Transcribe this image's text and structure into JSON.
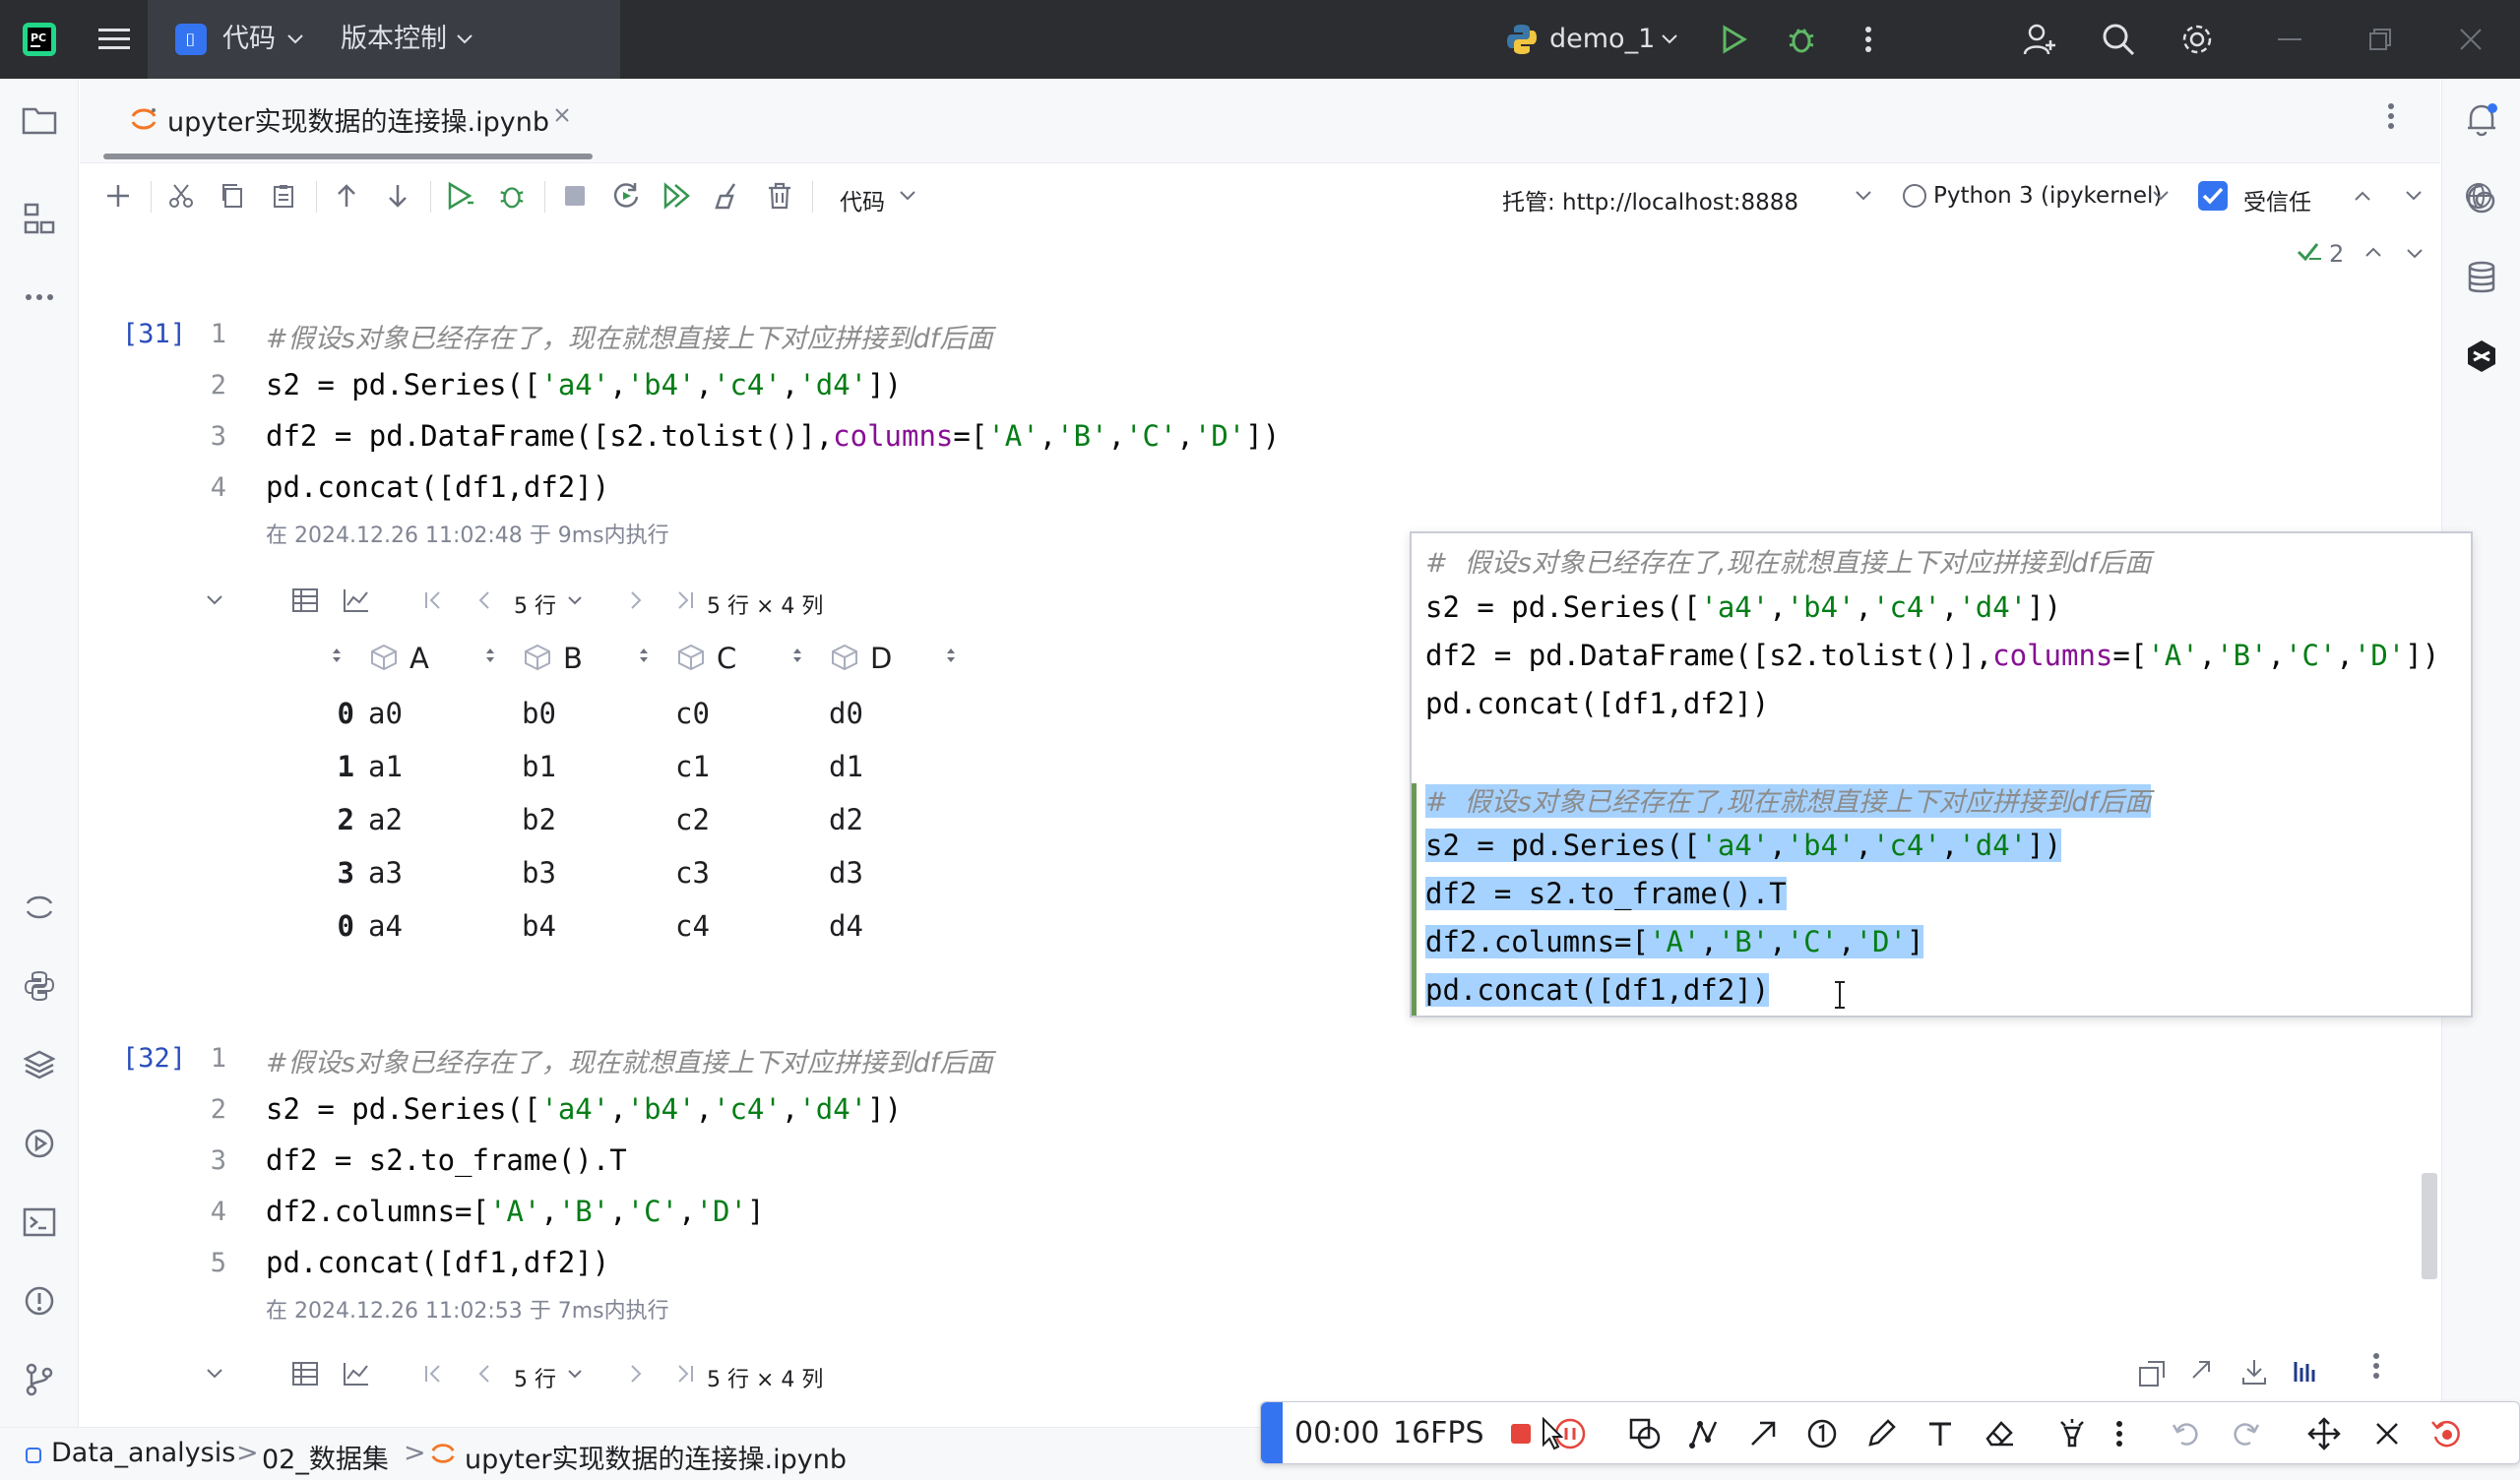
{
  "titlebar": {
    "app_logo": "pycharm-logo",
    "project_name": "代码",
    "vcs_label": "版本控制",
    "run_config": "demo_1"
  },
  "tab": {
    "file_name": "upyter实现数据的连接操.ipynb"
  },
  "nb_toolbar": {
    "cell_type": "代码",
    "host_label": "托管: http://localhost:8888",
    "kernel_label": "Python 3 (ipykernel)",
    "trusted_label": "受信任",
    "inspection_count": "2"
  },
  "cell31": {
    "exec_count": "[31]",
    "line_numbers": [
      "1",
      "2",
      "3",
      "4"
    ],
    "comment": "#假设s对象已经存在了，现在就想直接上下对应拼接到df后面",
    "line2": {
      "a": "s2 = pd.Series([",
      "s1": "'a4'",
      "c1": ",",
      "s2": "'b4'",
      "c2": ",",
      "s3": "'c4'",
      "c3": ",",
      "s4": "'d4'",
      "b": "])"
    },
    "line3": {
      "a": "df2 = pd.DataFrame([s2.tolist()],",
      "kw": "columns",
      "b": "=[",
      "s1": "'A'",
      "c1": ",",
      "s2": "'B'",
      "c2": ",",
      "s3": "'C'",
      "c3": ",",
      "s4": "'D'",
      "e": "])"
    },
    "line4": "pd.concat([df1,df2])",
    "meta": "在 2024.12.26 11:02:48 于 9ms内执行",
    "rows_select": "5 行",
    "shape": "5 行 × 4 列",
    "columns": [
      "A",
      "B",
      "C",
      "D"
    ],
    "index": [
      "0",
      "1",
      "2",
      "3",
      "0"
    ],
    "rows": [
      [
        "a0",
        "b0",
        "c0",
        "d0"
      ],
      [
        "a1",
        "b1",
        "c1",
        "d1"
      ],
      [
        "a2",
        "b2",
        "c2",
        "d2"
      ],
      [
        "a3",
        "b3",
        "c3",
        "d3"
      ],
      [
        "a4",
        "b4",
        "c4",
        "d4"
      ]
    ]
  },
  "cell32": {
    "exec_count": "[32]",
    "line_numbers": [
      "1",
      "2",
      "3",
      "4",
      "5"
    ],
    "comment": "#假设s对象已经存在了，现在就想直接上下对应拼接到df后面",
    "line2": {
      "a": "s2 = pd.Series([",
      "s1": "'a4'",
      "c1": ",",
      "s2": "'b4'",
      "c2": ",",
      "s3": "'c4'",
      "c3": ",",
      "s4": "'d4'",
      "b": "])"
    },
    "line3": "df2 = s2.to_frame().T",
    "line4": {
      "a": "df2.columns=[",
      "s1": "'A'",
      "c1": ",",
      "s2": "'B'",
      "c2": ",",
      "s3": "'C'",
      "c3": ",",
      "s4": "'D'",
      "b": "]"
    },
    "line5": "pd.concat([df1,df2])",
    "meta": "在 2024.12.26 11:02:53 于 7ms内执行",
    "rows_select": "5 行",
    "shape": "5 行 × 4 列"
  },
  "popup": {
    "l1": "#  假设s对象已经存在了,现在就想直接上下对应拼接到df后面",
    "l2a": "s2 = pd.Series([",
    "l2s1": "'a4'",
    "l2s2": "'b4'",
    "l2s3": "'c4'",
    "l2s4": "'d4'",
    "l2b": "])",
    "l3a": "df2 = pd.DataFrame([s2.tolist()],",
    "l3kw": "columns",
    "l3b": "=[",
    "l3s1": "'A'",
    "l3s2": "'B'",
    "l3s3": "'C'",
    "l3s4": "'D'",
    "l3c": "])",
    "l4": "pd.concat([df1,df2])",
    "l6": "#  假设s对象已经存在了,现在就想直接上下对应拼接到df后面",
    "l7a": "s2 = pd.Series([",
    "l7s1": "'a4'",
    "l7s2": "'b4'",
    "l7s3": "'c4'",
    "l7s4": "'d4'",
    "l7b": "])",
    "l8": "df2 = s2.to_frame().T",
    "l9a": "df2.columns=[",
    "l9s1": "'A'",
    "l9s2": "'B'",
    "l9s3": "'C'",
    "l9s4": "'D'",
    "l9b": "]",
    "l10": "pd.concat([df1,df2])",
    "comma": ","
  },
  "breadcrumb": {
    "items": [
      "Data_analysis",
      "02_数据集",
      "upyter实现数据的连接操.ipynb"
    ]
  },
  "recorder": {
    "time": "00:00",
    "fps": "16FPS"
  },
  "colors": {
    "accent": "#3574f0",
    "run_green": "#369650",
    "string_green": "#067d17",
    "keyword_purple": "#871094",
    "selection": "#a6d2ff",
    "record_red": "#e5453c"
  }
}
